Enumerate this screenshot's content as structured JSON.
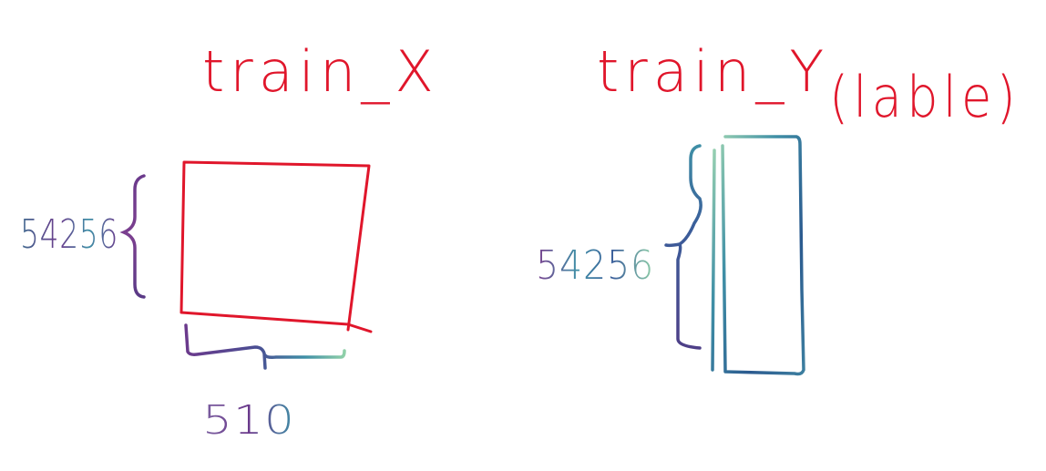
{
  "diagram": {
    "left": {
      "title": "train_X",
      "rows_label": "54256",
      "cols_label": "510"
    },
    "right": {
      "title": "train_Y",
      "suffix": "(lable)",
      "rows_label": "54256"
    }
  },
  "colors": {
    "title_red": "#e0162b",
    "box_red": "#e0162b",
    "brace_purple": "#6b3a8c",
    "brace_teal": "#3f8fa6",
    "brace_green": "#8fd0a8",
    "brace_navy": "#283d7a"
  }
}
